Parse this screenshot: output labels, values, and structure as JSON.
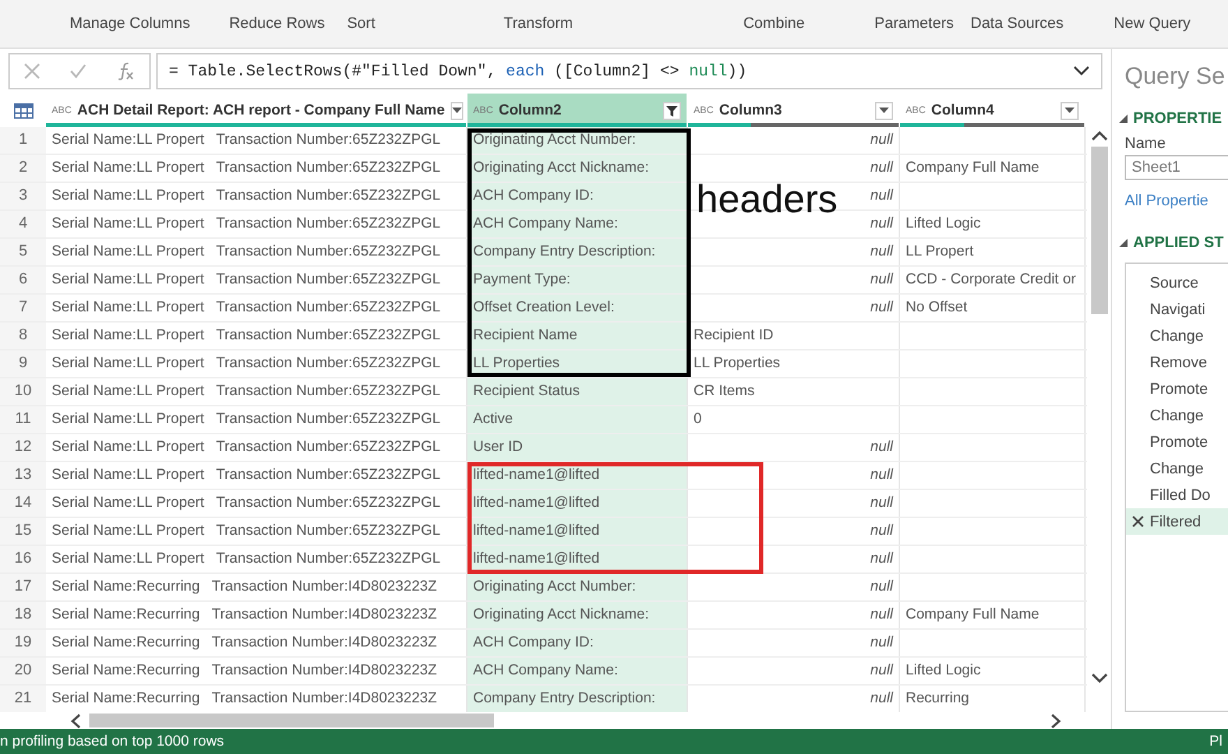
{
  "ribbon": {
    "groups": [
      "Manage Columns",
      "Reduce Rows",
      "Sort",
      "Transform",
      "Combine",
      "Parameters",
      "Data Sources",
      "New Query"
    ]
  },
  "formula_bar": {
    "parts": [
      {
        "text": "= Table.SelectRows(#\"Filled Down\", ",
        "kind": "plain"
      },
      {
        "text": "each",
        "kind": "keyword"
      },
      {
        "text": " ([Column2] <> ",
        "kind": "plain"
      },
      {
        "text": "null",
        "kind": "literal"
      },
      {
        "text": "))",
        "kind": "plain"
      }
    ]
  },
  "table": {
    "columns": [
      {
        "type_label": "ABC",
        "name": "ACH Detail Report: ACH report - Company Full Name",
        "selected": false,
        "filtered": false,
        "level": 1
      },
      {
        "type_label": "ABC",
        "name": "Column2",
        "selected": true,
        "filtered": true,
        "level": 1
      },
      {
        "type_label": "ABC",
        "name": "Column3",
        "selected": false,
        "filtered": false,
        "level": 0.3
      },
      {
        "type_label": "ABC",
        "name": "Column4",
        "selected": false,
        "filtered": false,
        "level": 0.35
      }
    ],
    "rows": [
      {
        "n": "1",
        "c1": "Serial Name:LL Propert   Transaction Number:65Z232ZPGL",
        "c2": "Originating Acct Number:",
        "c3": {
          "text": "null",
          "kind": "null"
        }
      },
      {
        "n": "2",
        "c1": "Serial Name:LL Propert   Transaction Number:65Z232ZPGL",
        "c2": "Originating Acct Nickname:",
        "c3": {
          "text": "null",
          "kind": "null"
        },
        "c4": "Company Full Name"
      },
      {
        "n": "3",
        "c1": "Serial Name:LL Propert   Transaction Number:65Z232ZPGL",
        "c2": "ACH Company ID:",
        "c3": {
          "text": "null",
          "kind": "null"
        }
      },
      {
        "n": "4",
        "c1": "Serial Name:LL Propert   Transaction Number:65Z232ZPGL",
        "c2": "ACH Company Name:",
        "c3": {
          "text": "null",
          "kind": "null"
        },
        "c4": "Lifted Logic"
      },
      {
        "n": "5",
        "c1": "Serial Name:LL Propert   Transaction Number:65Z232ZPGL",
        "c2": "Company Entry Description:",
        "c3": {
          "text": "null",
          "kind": "null"
        },
        "c4": "LL Propert"
      },
      {
        "n": "6",
        "c1": "Serial Name:LL Propert   Transaction Number:65Z232ZPGL",
        "c2": "Payment Type:",
        "c3": {
          "text": "null",
          "kind": "null"
        },
        "c4": "CCD - Corporate Credit or"
      },
      {
        "n": "7",
        "c1": "Serial Name:LL Propert   Transaction Number:65Z232ZPGL",
        "c2": "Offset Creation Level:",
        "c3": {
          "text": "null",
          "kind": "null"
        },
        "c4": "No Offset"
      },
      {
        "n": "8",
        "c1": "Serial Name:LL Propert   Transaction Number:65Z232ZPGL",
        "c2": "Recipient Name",
        "c3": {
          "text": "Recipient ID",
          "kind": "value"
        }
      },
      {
        "n": "9",
        "c1": "Serial Name:LL Propert   Transaction Number:65Z232ZPGL",
        "c2": "LL Properties",
        "c3": {
          "text": "LL Properties",
          "kind": "value"
        }
      },
      {
        "n": "10",
        "c1": "Serial Name:LL Propert   Transaction Number:65Z232ZPGL",
        "c2": "Recipient Status",
        "c3": {
          "text": "CR Items",
          "kind": "value"
        }
      },
      {
        "n": "11",
        "c1": "Serial Name:LL Propert   Transaction Number:65Z232ZPGL",
        "c2": "Active",
        "c3": {
          "text": "0",
          "kind": "value"
        }
      },
      {
        "n": "12",
        "c1": "Serial Name:LL Propert   Transaction Number:65Z232ZPGL",
        "c2": "User ID",
        "c3": {
          "text": "null",
          "kind": "null"
        }
      },
      {
        "n": "13",
        "c1": "Serial Name:LL Propert   Transaction Number:65Z232ZPGL",
        "c2": "lifted-name1@lifted",
        "c3": {
          "text": "null",
          "kind": "null"
        }
      },
      {
        "n": "14",
        "c1": "Serial Name:LL Propert   Transaction Number:65Z232ZPGL",
        "c2": "lifted-name1@lifted",
        "c3": {
          "text": "null",
          "kind": "null"
        }
      },
      {
        "n": "15",
        "c1": "Serial Name:LL Propert   Transaction Number:65Z232ZPGL",
        "c2": "lifted-name1@lifted",
        "c3": {
          "text": "null",
          "kind": "null"
        }
      },
      {
        "n": "16",
        "c1": "Serial Name:LL Propert   Transaction Number:65Z232ZPGL",
        "c2": "lifted-name1@lifted",
        "c3": {
          "text": "null",
          "kind": "null"
        }
      },
      {
        "n": "17",
        "c1": "Serial Name:Recurring   Transaction Number:I4D8023223Z",
        "c2": "Originating Acct Number:",
        "c3": {
          "text": "null",
          "kind": "null"
        }
      },
      {
        "n": "18",
        "c1": "Serial Name:Recurring   Transaction Number:I4D8023223Z",
        "c2": "Originating Acct Nickname:",
        "c3": {
          "text": "null",
          "kind": "null"
        },
        "c4": "Company Full Name"
      },
      {
        "n": "19",
        "c1": "Serial Name:Recurring   Transaction Number:I4D8023223Z",
        "c2": "ACH Company ID:",
        "c3": {
          "text": "null",
          "kind": "null"
        }
      },
      {
        "n": "20",
        "c1": "Serial Name:Recurring   Transaction Number:I4D8023223Z",
        "c2": "ACH Company Name:",
        "c3": {
          "text": "null",
          "kind": "null"
        },
        "c4": "Lifted Logic"
      },
      {
        "n": "21",
        "c1": "Serial Name:Recurring   Transaction Number:I4D8023223Z",
        "c2": "Company Entry Description:",
        "c3": {
          "text": "null",
          "kind": "null"
        },
        "c4": "Recurring"
      }
    ]
  },
  "annotations": [
    {
      "kind": "box",
      "color": "#000000",
      "label": "headers"
    },
    {
      "kind": "box",
      "color": "#e02828"
    }
  ],
  "query_settings": {
    "title": "Query Se",
    "properties_heading": "PROPERTIE",
    "name_label": "Name",
    "name_value": "Sheet1",
    "all_properties_link": "All Propertie",
    "steps_heading": "APPLIED ST",
    "steps": [
      {
        "name": "Source",
        "selected": false
      },
      {
        "name": "Navigati",
        "selected": false
      },
      {
        "name": "Change",
        "selected": false
      },
      {
        "name": "Remove",
        "selected": false
      },
      {
        "name": "Promote",
        "selected": false
      },
      {
        "name": "Change",
        "selected": false
      },
      {
        "name": "Promote",
        "selected": false
      },
      {
        "name": "Change",
        "selected": false
      },
      {
        "name": "Filled Do",
        "selected": false
      },
      {
        "name": "Filtered",
        "selected": true
      }
    ]
  },
  "status_bar": {
    "left": "n profiling based on top 1000 rows",
    "right": "Pl"
  }
}
